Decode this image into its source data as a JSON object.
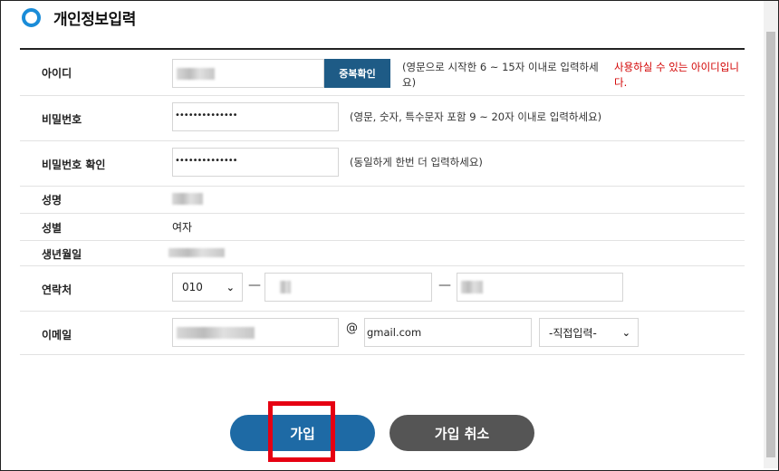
{
  "page": {
    "title": "개인정보입력"
  },
  "rows": {
    "id": {
      "label": "아이디",
      "check_button": "중복확인",
      "hint": "(영문으로 시작한 6 ~ 15자 이내로 입력하세요)",
      "status": "사용하실 수 있는 아이디입니다."
    },
    "password": {
      "label": "비밀번호",
      "value": "••••••••••••••",
      "hint": "(영문, 숫자, 특수문자 포함 9 ~ 20자 이내로 입력하세요)"
    },
    "password_confirm": {
      "label": "비밀번호 확인",
      "value": "••••••••••••••",
      "hint": "(동일하게 한번 더 입력하세요)"
    },
    "name": {
      "label": "성명"
    },
    "gender": {
      "label": "성별",
      "value": "여자"
    },
    "birth": {
      "label": "생년월일"
    },
    "phone": {
      "label": "연락처",
      "prefix": "010",
      "sep": "—"
    },
    "email": {
      "label": "이메일",
      "at": "@",
      "domain": "gmail.com",
      "domain_select": "-직접입력-"
    }
  },
  "buttons": {
    "join": "가입",
    "cancel": "가입 취소"
  },
  "colors": {
    "accent": "#1a8cd8",
    "primary_button": "#1e6aa5",
    "cancel_button": "#555555",
    "error_text": "#d20000",
    "highlight_box": "#e60012"
  }
}
